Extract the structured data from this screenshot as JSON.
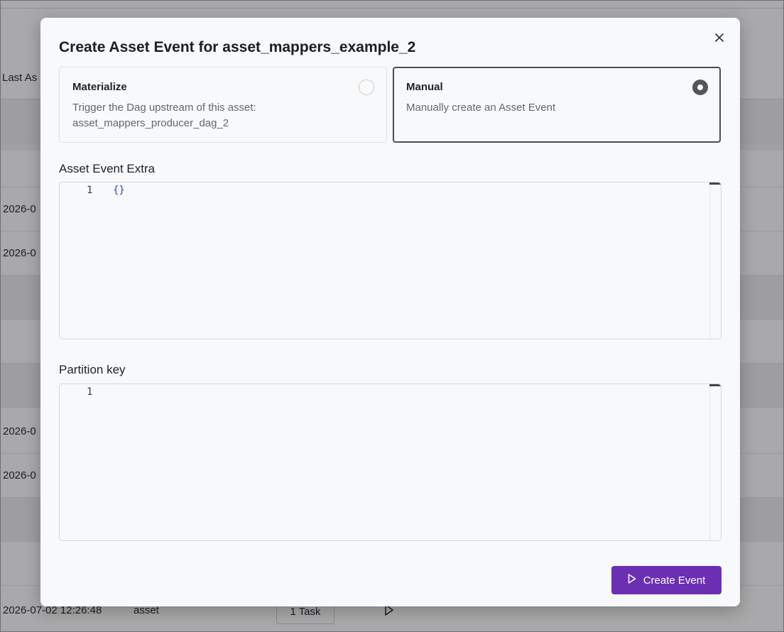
{
  "background": {
    "header_text": "Last As",
    "rows": [
      {
        "date": "2026-0"
      },
      {
        "date": "2026-0"
      },
      {
        "date": "2026-0"
      },
      {
        "date": "2026-0"
      }
    ],
    "last_row": {
      "date": "2026-07-02 12:26:48",
      "type": "asset",
      "task_button": "1 Task"
    }
  },
  "modal": {
    "title": "Create Asset Event for asset_mappers_example_2",
    "options": {
      "materialize": {
        "title": "Materialize",
        "description": "Trigger the Dag upstream of this asset: asset_mappers_producer_dag_2",
        "selected": false
      },
      "manual": {
        "title": "Manual",
        "description": "Manually create an Asset Event",
        "selected": true
      }
    },
    "extra": {
      "label": "Asset Event Extra",
      "line_number": "1",
      "value": "{}"
    },
    "partition": {
      "label": "Partition key",
      "line_number": "1",
      "value": ""
    },
    "submit_label": "Create Event"
  },
  "colors": {
    "accent": "#6b2fb3",
    "json_brace": "#2f45c9"
  },
  "icons": {
    "close": "close-icon",
    "play": "play-icon"
  }
}
